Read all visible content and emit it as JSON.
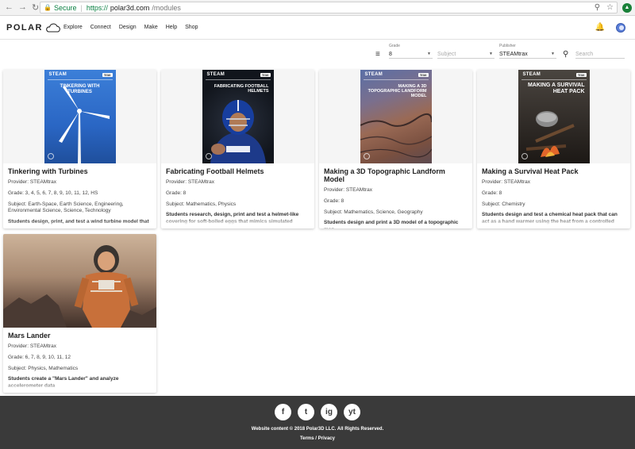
{
  "browser": {
    "secure_label": "Secure",
    "url_protocol": "https://",
    "url_host": "polar3d.com",
    "url_path": "/modules"
  },
  "header": {
    "logo_text": "POLAR",
    "menu": [
      "Explore",
      "Connect",
      "Design",
      "Make",
      "Help",
      "Shop"
    ]
  },
  "filters": {
    "grade_label": "Grade",
    "grade_value": "8",
    "subject_placeholder": "Subject",
    "publisher_label": "Publisher",
    "publisher_value": "STEAMtrax",
    "search_placeholder": "Search"
  },
  "cards": [
    {
      "title": "Tinkering with Turbines",
      "provider": "Provider: STEAMtrax",
      "grade": "Grade: 3, 4, 5, 6, 7, 8, 9, 10, 11, 12, HS",
      "subject": "Subject: Earth-Space, Earth Science, Engineering, Environmental Science, Science, Technology",
      "description": "Students design, print, and test a wind turbine model that",
      "cover_title": "TINKERING WITH TURBINES"
    },
    {
      "title": "Fabricating Football Helmets",
      "provider": "Provider: STEAMtrax",
      "grade": "Grade: 8",
      "subject": "Subject: Mathematics, Physics",
      "description": "Students research, design, print and test a helmet-like covering for soft-boiled eggs that mimics simulated",
      "cover_title": "FABRICATING FOOTBALL HELMETS"
    },
    {
      "title": "Making a 3D Topographic Landform Model",
      "provider": "Provider: STEAMtrax",
      "grade": "Grade: 8",
      "subject": "Subject: Mathematics, Science, Geography",
      "description": "Students design and print a 3D model of a topographic map",
      "cover_title": "MAKING A 3D TOPOGRAPHIC LANDFORM MODEL"
    },
    {
      "title": "Making a Survival Heat Pack",
      "provider": "Provider: STEAMtrax",
      "grade": "Grade: 8",
      "subject": "Subject: Chemistry",
      "description": "Students design and test a chemical heat pack that can act as a hand warmer using the heat from a controlled",
      "cover_title": "MAKING A SURVIVAL HEAT PACK"
    },
    {
      "title": "Mars Lander",
      "provider": "Provider: STEAMtrax",
      "grade": "Grade: 6, 7, 8, 9, 10, 11, 12",
      "subject": "Subject: Physics, Mathematics",
      "description": "Students create a \"Mars Lander\" and analyze accelerometer data"
    }
  ],
  "cover_badge": {
    "steam": "STEAM",
    "trax": "trax"
  },
  "footer": {
    "social": [
      "f",
      "t",
      "ig",
      "yt"
    ],
    "copyright": "Website content © 2018 Polar3D LLC. All Rights Reserved.",
    "terms": "Terms",
    "privacy": "Privacy"
  }
}
